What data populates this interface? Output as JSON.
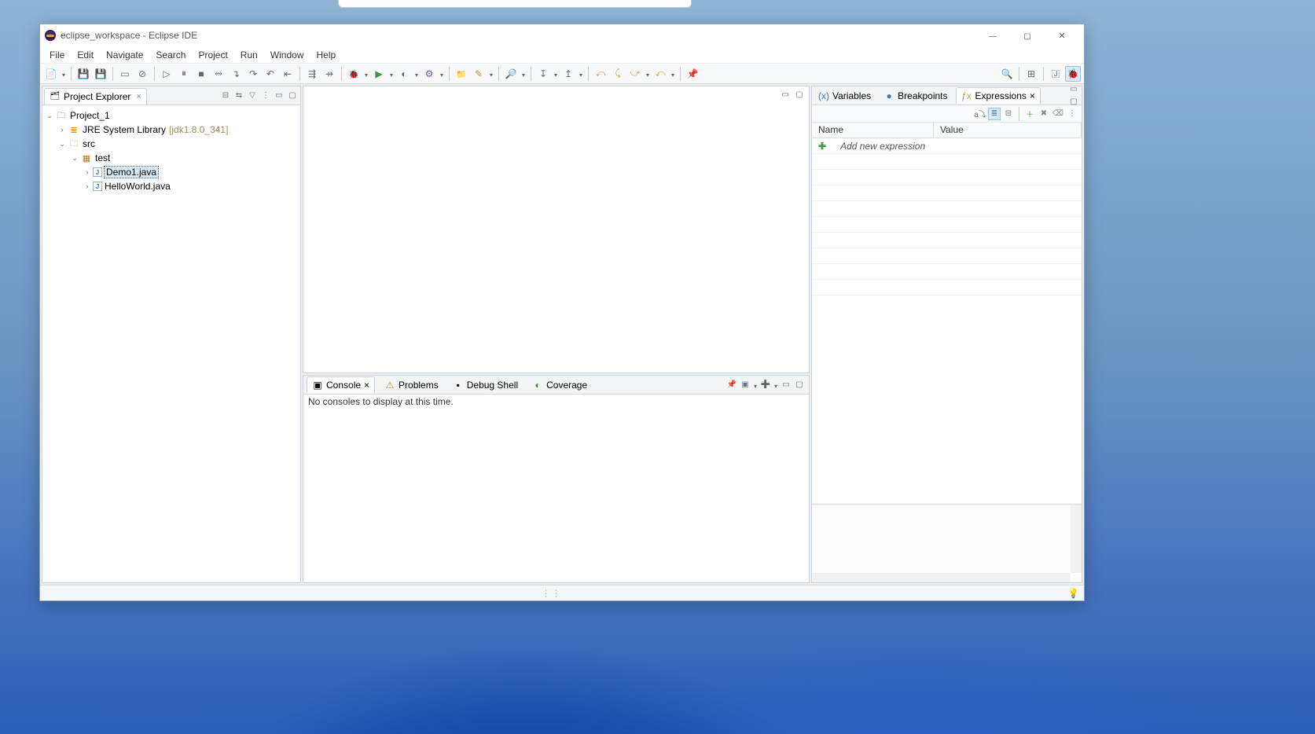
{
  "window": {
    "title": "eclipse_workspace - Eclipse IDE"
  },
  "menu": [
    "File",
    "Edit",
    "Navigate",
    "Search",
    "Project",
    "Run",
    "Window",
    "Help"
  ],
  "project_explorer": {
    "title": "Project Explorer",
    "tree": {
      "project": "Project_1",
      "jre": {
        "label": "JRE System Library",
        "qualifier": "[jdk1.8.0_341]"
      },
      "src": "src",
      "pkg": "test",
      "files": [
        "Demo1.java",
        "HelloWorld.java"
      ],
      "selected": "Demo1.java"
    }
  },
  "right_panel": {
    "tabs": [
      "Variables",
      "Breakpoints",
      "Expressions"
    ],
    "active_tab": "Expressions",
    "columns": {
      "name": "Name",
      "value": "Value"
    },
    "add_new": "Add new expression"
  },
  "bottom_panel": {
    "tabs": [
      "Console",
      "Problems",
      "Debug Shell",
      "Coverage"
    ],
    "active_tab": "Console",
    "console_empty_msg": "No consoles to display at this time."
  }
}
